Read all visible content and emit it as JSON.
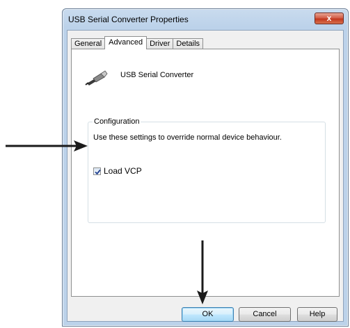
{
  "window": {
    "title": "USB Serial Converter Properties",
    "close_label": "x"
  },
  "tabs": [
    {
      "label": "General",
      "active": false
    },
    {
      "label": "Advanced",
      "active": true
    },
    {
      "label": "Driver",
      "active": false
    },
    {
      "label": "Details",
      "active": false
    }
  ],
  "device": {
    "icon": "usb-plug-icon",
    "name": "USB Serial Converter"
  },
  "configuration": {
    "group_label": "Configuration",
    "description": "Use these settings to override normal device behaviour.",
    "checkbox_label": "Load VCP",
    "checkbox_checked": true
  },
  "buttons": {
    "ok": "OK",
    "cancel": "Cancel",
    "help": "Help"
  },
  "annotations": {
    "arrow_color": "#1a1a1a"
  },
  "colors": {
    "close_button": "#c2381f",
    "default_button_border": "#3c7fb1",
    "checkbox_check": "#1f3f8f"
  }
}
